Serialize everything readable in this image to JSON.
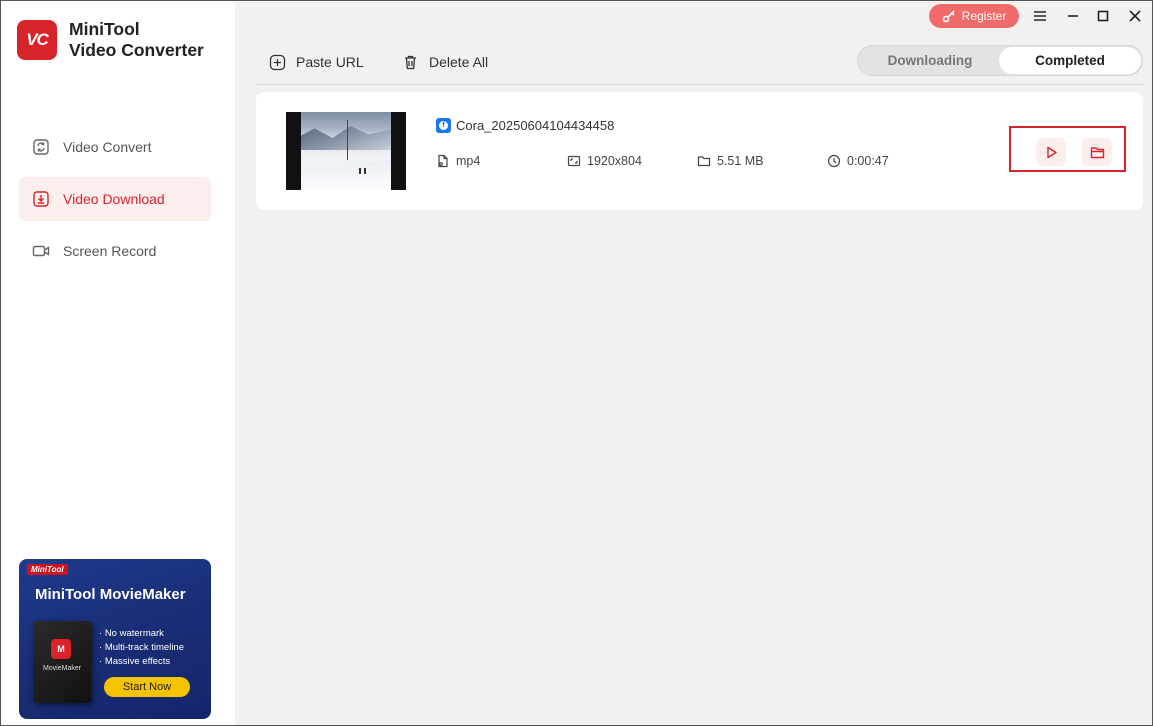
{
  "app": {
    "logo_text": "VC",
    "name_line1": "MiniTool",
    "name_line2": "Video Converter"
  },
  "sidebar": {
    "items": [
      {
        "label": "Video Convert",
        "icon": "convert-icon",
        "active": false
      },
      {
        "label": "Video Download",
        "icon": "download-icon",
        "active": true
      },
      {
        "label": "Screen Record",
        "icon": "camera-icon",
        "active": false
      }
    ]
  },
  "promo": {
    "brand": "MiniTool",
    "title": "MiniTool MovieMaker",
    "box_name": "MovieMaker",
    "features": [
      "No watermark",
      "Multi-track timeline",
      "Massive effects"
    ],
    "cta": "Start Now"
  },
  "titlebar": {
    "register_label": "Register"
  },
  "toolbar": {
    "paste_url_label": "Paste URL",
    "delete_all_label": "Delete All"
  },
  "tabs": {
    "downloading": "Downloading",
    "completed": "Completed",
    "selected": "Completed"
  },
  "download_item": {
    "title": "Cora_20250604104434458",
    "source_icon": "facebook-icon",
    "format": "mp4",
    "resolution": "1920x804",
    "size": "5.51 MB",
    "duration": "0:00:47"
  },
  "colors": {
    "accent": "#d8232a",
    "register": "#f06a6a",
    "promo_bg": "#1e3a8f",
    "cta": "#f5c400"
  }
}
